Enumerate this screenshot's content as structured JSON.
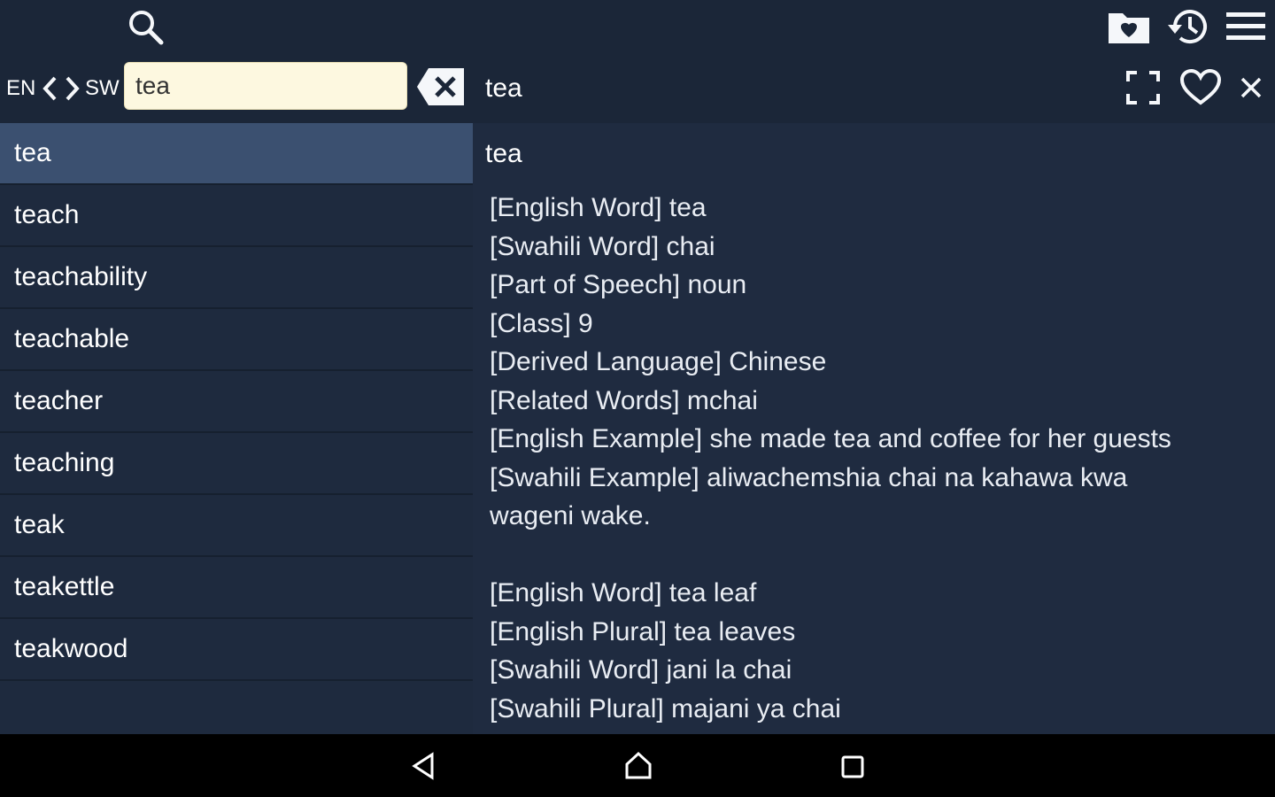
{
  "toolbar": {
    "lang_from": "EN",
    "lang_to": "SW",
    "search_value": "tea",
    "header_word": "tea",
    "icons": [
      "search-icon",
      "favorites-folder-icon",
      "history-icon",
      "menu-icon",
      "swap-left-icon",
      "swap-right-icon",
      "clear-icon",
      "fullscreen-icon",
      "heart-icon",
      "close-icon"
    ]
  },
  "word_list": [
    {
      "label": "tea",
      "selected": true
    },
    {
      "label": "teach"
    },
    {
      "label": "teachability"
    },
    {
      "label": "teachable"
    },
    {
      "label": "teacher"
    },
    {
      "label": "teaching"
    },
    {
      "label": "teak"
    },
    {
      "label": "teakettle"
    },
    {
      "label": "teakwood"
    }
  ],
  "detail": {
    "title": "tea",
    "lines": [
      "[English Word] tea",
      "[Swahili Word] chai",
      "[Part of Speech] noun",
      "[Class] 9",
      "[Derived Language] Chinese",
      "[Related Words] mchai",
      "[English Example] she made tea and coffee for her guests",
      "[Swahili Example] aliwachemshia chai na kahawa kwa",
      "wageni wake.",
      "",
      "[English Word] tea leaf",
      "[English Plural] tea leaves",
      "[Swahili Word] jani la chai",
      "[Swahili Plural] majani ya chai"
    ]
  },
  "navbar": {
    "icons": [
      "back-icon",
      "home-icon",
      "recents-icon"
    ]
  },
  "colors": {
    "background": "#1b2638",
    "selected_row": "#3b5070",
    "search_field": "#fdf8e0",
    "navbar": "#000000"
  }
}
